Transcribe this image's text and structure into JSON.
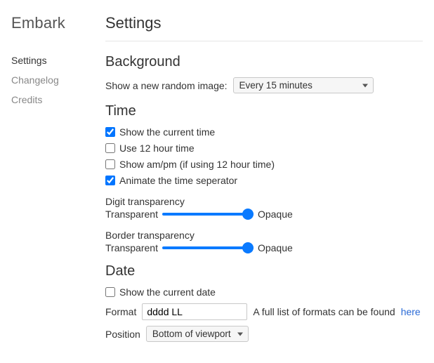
{
  "brand": "Embark",
  "sidebar": {
    "items": [
      {
        "label": "Settings",
        "active": true
      },
      {
        "label": "Changelog",
        "active": false
      },
      {
        "label": "Credits",
        "active": false
      }
    ]
  },
  "page": {
    "title": "Settings"
  },
  "sections": {
    "background": {
      "title": "Background",
      "random_image_label": "Show a new random image:",
      "random_image_value": "Every 15 minutes"
    },
    "time": {
      "title": "Time",
      "show_time_label": "Show the current time",
      "show_time_checked": true,
      "twelve_hour_label": "Use 12 hour time",
      "twelve_hour_checked": false,
      "ampm_label": "Show am/pm (if using 12 hour time)",
      "ampm_checked": false,
      "animate_label": "Animate the time seperator",
      "animate_checked": true,
      "digit_transparency_label": "Digit transparency",
      "border_transparency_label": "Border transparency",
      "slider_min_label": "Transparent",
      "slider_max_label": "Opaque",
      "digit_transparency_value": 100,
      "border_transparency_value": 100
    },
    "date": {
      "title": "Date",
      "show_date_label": "Show the current date",
      "show_date_checked": false,
      "format_label": "Format",
      "format_value": "dddd LL",
      "format_help_prefix": "A full list of formats can be found ",
      "format_help_link": "here",
      "position_label": "Position",
      "position_value": "Bottom of viewport"
    }
  }
}
